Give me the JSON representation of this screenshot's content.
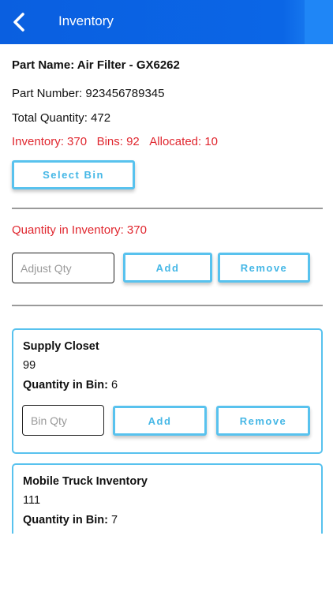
{
  "header": {
    "title": "Inventory"
  },
  "part": {
    "name_label": "Part Name: Air Filter - GX6262",
    "number_label": "Part Number: 923456789345",
    "total_label": "Total Quantity: 472",
    "inventory_label": "Inventory: 370",
    "bins_label": "Bins: 92",
    "allocated_label": "Allocated: 10"
  },
  "select_bin_label": "Select Bin",
  "inventory_adjust": {
    "quantity_label": "Quantity in Inventory: 370",
    "placeholder": "Adjust Qty",
    "add_label": "Add",
    "remove_label": "Remove"
  },
  "bins": [
    {
      "name": "Supply Closet",
      "number": "99",
      "qty_label": "Quantity in Bin:",
      "qty": "6",
      "placeholder": "Bin Qty",
      "add_label": "Add",
      "remove_label": "Remove"
    },
    {
      "name": "Mobile Truck Inventory",
      "number": "111",
      "qty_label": "Quantity in Bin:",
      "qty": "7"
    }
  ],
  "colors": {
    "header": "#0a5fe0",
    "accent": "#58c2ee",
    "alert": "#e0262e"
  }
}
